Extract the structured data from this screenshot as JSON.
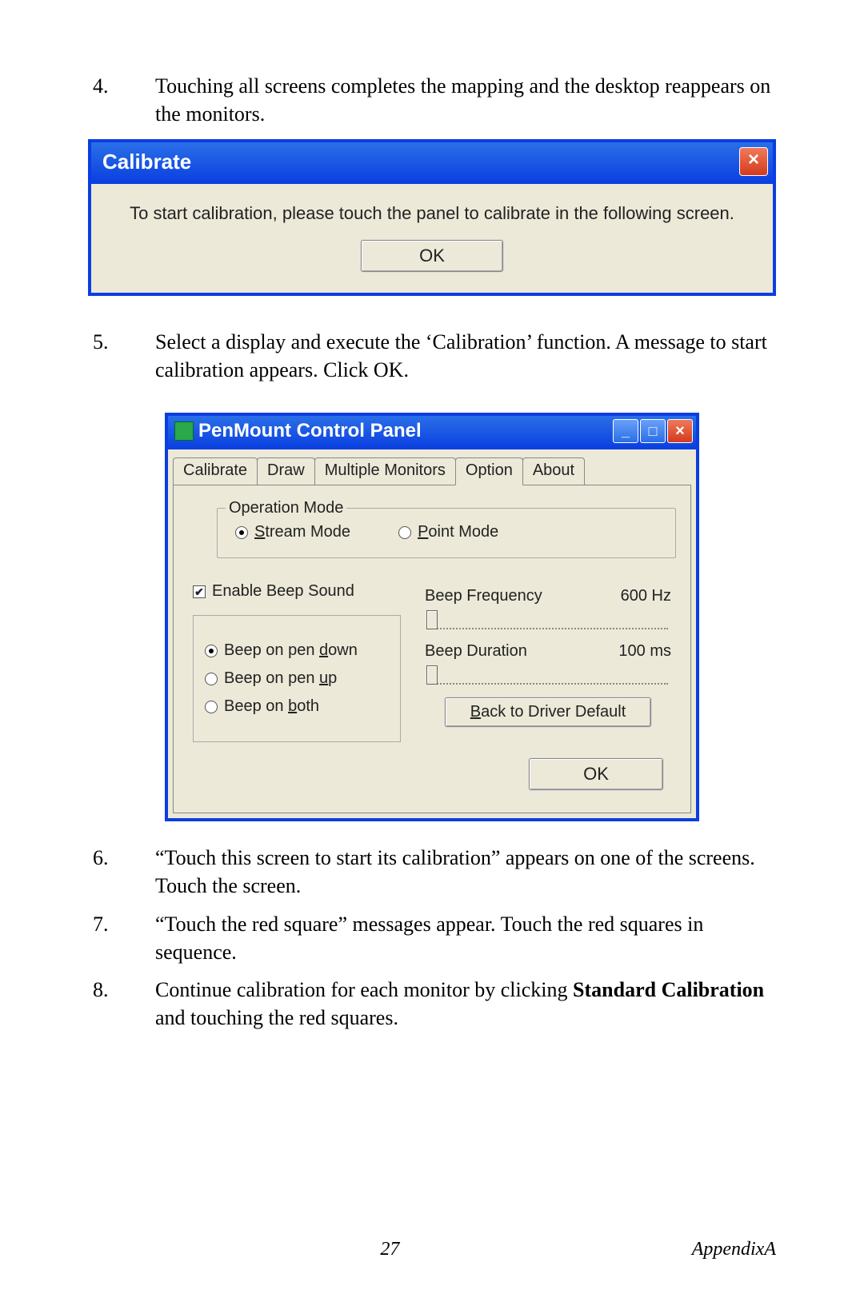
{
  "steps": {
    "s4_num": "4.",
    "s4": "Touching all screens completes the mapping and the desktop reappears on the monitors.",
    "s5_num": "5.",
    "s5": "Select a display and execute the ‘Calibration’ function. A message to start calibration appears. Click OK.",
    "s6_num": "6.",
    "s6": "“Touch this screen to start its calibration” appears on one of the screens. Touch the screen.",
    "s7_num": "7.",
    "s7": "“Touch the red square” messages appear. Touch the red squares in sequence.",
    "s8_num": "8.",
    "s8_pre": "Continue calibration for each monitor by clicking ",
    "s8_bold": "Standard Calibration",
    "s8_post": " and touching the red squares."
  },
  "dialog1": {
    "title": "Calibrate",
    "message": "To start calibration, please touch the panel to calibrate in the following screen.",
    "ok": "OK"
  },
  "dialog2": {
    "title": "PenMount Control Panel",
    "tabs": {
      "calibrate": "Calibrate",
      "draw": "Draw",
      "multiple": "Multiple Monitors",
      "option": "Option",
      "about": "About"
    },
    "group_operation": "Operation Mode",
    "radio_stream_pre": "",
    "radio_stream_u": "S",
    "radio_stream_post": "tream Mode",
    "radio_point_pre": "",
    "radio_point_u": "P",
    "radio_point_post": "oint Mode",
    "enable_beep": "Enable Beep Sound",
    "beep_down_pre": "Beep on pen ",
    "beep_down_u": "d",
    "beep_down_post": "own",
    "beep_up_pre": "Beep on pen ",
    "beep_up_u": "u",
    "beep_up_post": "p",
    "beep_both_pre": "Beep on ",
    "beep_both_u": "b",
    "beep_both_post": "oth",
    "freq_label": "Beep Frequency",
    "freq_value": "600 Hz",
    "dur_label": "Beep Duration",
    "dur_value": "100  ms",
    "driver_default_u": "B",
    "driver_default_post": "ack to Driver Default",
    "ok": "OK"
  },
  "footer": {
    "page": "27",
    "section": "AppendixA"
  },
  "win_controls": {
    "close": "×",
    "min": "_",
    "max": "□"
  }
}
